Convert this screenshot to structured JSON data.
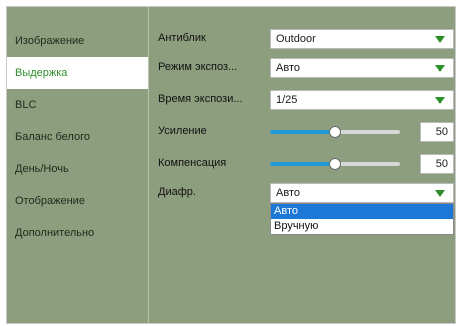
{
  "sidebar": {
    "items": [
      {
        "label": "Изображение",
        "active": false
      },
      {
        "label": "Выдержка",
        "active": true
      },
      {
        "label": "BLC",
        "active": false
      },
      {
        "label": "Баланс белого",
        "active": false
      },
      {
        "label": "День/Ночь",
        "active": false
      },
      {
        "label": "Отображение",
        "active": false
      },
      {
        "label": "Дополнительно",
        "active": false
      }
    ]
  },
  "settings": {
    "antiflicker": {
      "label": "Антиблик",
      "value": "Outdoor"
    },
    "exposure_mode": {
      "label": "Режим экспоз...",
      "value": "Авто"
    },
    "exposure_time": {
      "label": "Время экспози...",
      "value": "1/25"
    },
    "gain": {
      "label": "Усиление",
      "value": "50",
      "fraction": 0.5
    },
    "compensation": {
      "label": "Компенсация",
      "value": "50",
      "fraction": 0.5
    },
    "iris": {
      "label": "Диафр.",
      "value": "Авто",
      "options": [
        "Авто",
        "Вручную"
      ],
      "selected_index": 0
    }
  },
  "colors": {
    "background": "#8d9e7e",
    "accent_green": "#2e8f2a",
    "slider_blue": "#1f9bd8",
    "selection_blue": "#1c78d6"
  },
  "icons": {
    "select_arrow": "triangle-down-icon"
  }
}
